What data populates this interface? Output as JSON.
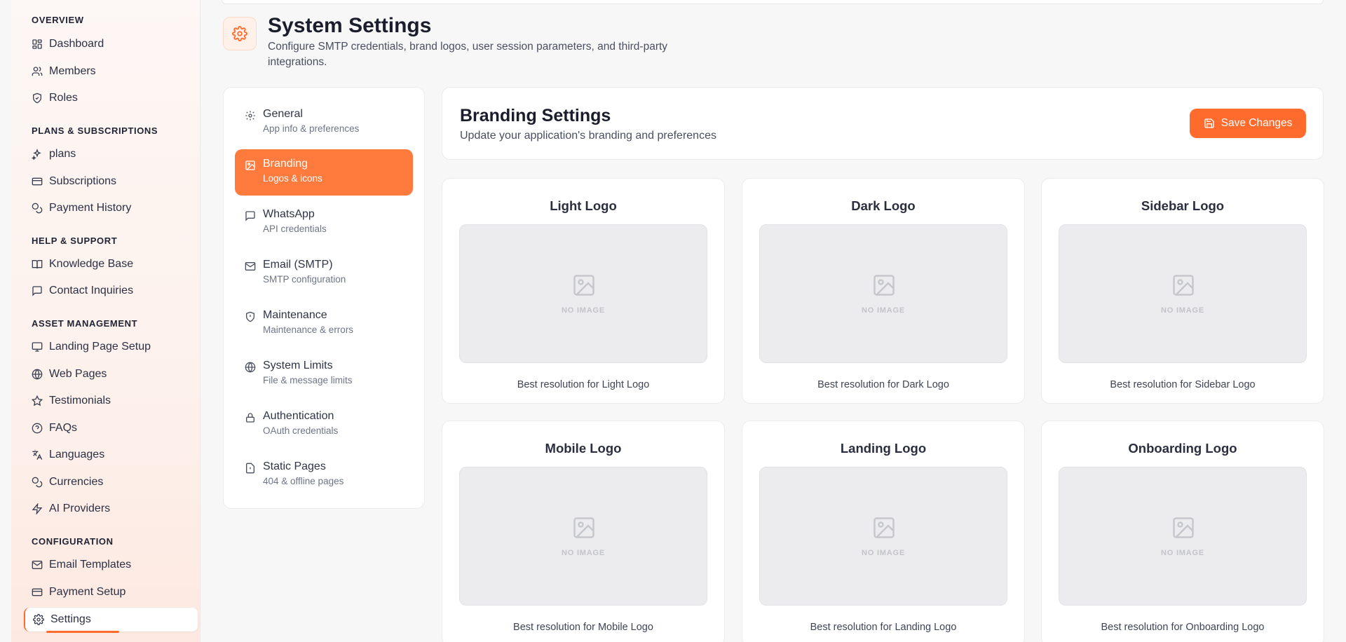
{
  "sidebar": {
    "sections": [
      {
        "title": "OVERVIEW",
        "items": [
          {
            "label": "Dashboard",
            "icon": "dashboard-icon"
          },
          {
            "label": "Members",
            "icon": "users-icon"
          },
          {
            "label": "Roles",
            "icon": "shield-check-icon"
          }
        ]
      },
      {
        "title": "PLANS & SUBSCRIPTIONS",
        "items": [
          {
            "label": "plans",
            "icon": "sparkles-icon"
          },
          {
            "label": "Subscriptions",
            "icon": "credit-card-icon"
          },
          {
            "label": "Payment History",
            "icon": "coins-icon"
          }
        ]
      },
      {
        "title": "HELP & SUPPORT",
        "items": [
          {
            "label": "Knowledge Base",
            "icon": "book-open-icon"
          },
          {
            "label": "Contact Inquiries",
            "icon": "message-square-icon"
          }
        ]
      },
      {
        "title": "ASSET MANAGEMENT",
        "items": [
          {
            "label": "Landing Page Setup",
            "icon": "monitor-icon"
          },
          {
            "label": "Web Pages",
            "icon": "globe-icon"
          },
          {
            "label": "Testimonials",
            "icon": "star-icon"
          },
          {
            "label": "FAQs",
            "icon": "help-circle-icon"
          },
          {
            "label": "Languages",
            "icon": "languages-icon"
          },
          {
            "label": "Currencies",
            "icon": "coins-icon"
          },
          {
            "label": "AI Providers",
            "icon": "zap-icon"
          }
        ]
      },
      {
        "title": "CONFIGURATION",
        "items": [
          {
            "label": "Email Templates",
            "icon": "mail-icon"
          },
          {
            "label": "Payment Setup",
            "icon": "credit-card-icon"
          },
          {
            "label": "Settings",
            "icon": "settings-icon",
            "active": true
          }
        ]
      }
    ]
  },
  "header": {
    "title": "System Settings",
    "subtitle": "Configure SMTP credentials, brand logos, user session parameters, and third-party integrations."
  },
  "settings_menu": {
    "items": [
      {
        "label": "General",
        "sub": "App info & preferences",
        "icon": "settings-icon"
      },
      {
        "label": "Branding",
        "sub": "Logos & icons",
        "icon": "image-icon",
        "active": true
      },
      {
        "label": "WhatsApp",
        "sub": "API credentials",
        "icon": "message-square-icon"
      },
      {
        "label": "Email (SMTP)",
        "sub": "SMTP configuration",
        "icon": "mail-icon"
      },
      {
        "label": "Maintenance",
        "sub": "Maintenance & errors",
        "icon": "shield-icon"
      },
      {
        "label": "System Limits",
        "sub": "File & message limits",
        "icon": "globe-icon"
      },
      {
        "label": "Authentication",
        "sub": "OAuth credentials",
        "icon": "lock-icon"
      },
      {
        "label": "Static Pages",
        "sub": "404 & offline pages",
        "icon": "file-icon"
      }
    ]
  },
  "branding": {
    "title": "Branding Settings",
    "subtitle": "Update your application's branding and preferences",
    "save_label": "Save Changes",
    "logos": [
      {
        "title": "Light Logo",
        "placeholder": "NO IMAGE",
        "hint": "Best resolution for Light Logo"
      },
      {
        "title": "Dark Logo",
        "placeholder": "NO IMAGE",
        "hint": "Best resolution for Dark Logo"
      },
      {
        "title": "Sidebar Logo",
        "placeholder": "NO IMAGE",
        "hint": "Best resolution for Sidebar Logo"
      },
      {
        "title": "Mobile Logo",
        "placeholder": "NO IMAGE",
        "hint": "Best resolution for Mobile Logo"
      },
      {
        "title": "Landing Logo",
        "placeholder": "NO IMAGE",
        "hint": "Best resolution for Landing Logo"
      },
      {
        "title": "Onboarding Logo",
        "placeholder": "NO IMAGE",
        "hint": "Best resolution for Onboarding Logo"
      }
    ]
  },
  "colors": {
    "accent": "#ff6b2c",
    "accent_light": "#ff7a3d"
  }
}
